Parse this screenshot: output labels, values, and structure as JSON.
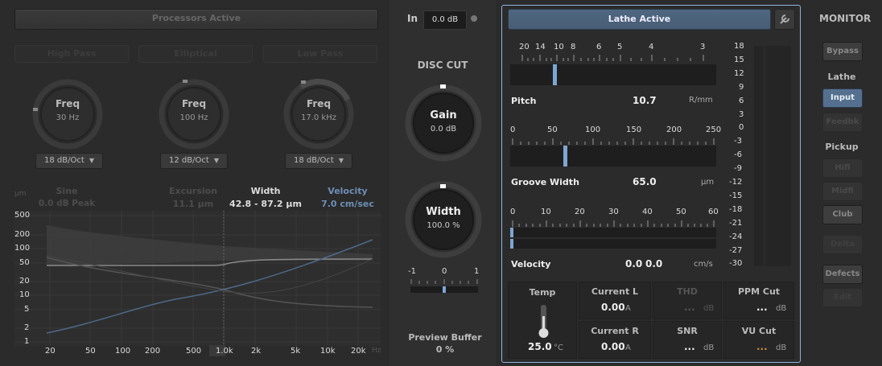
{
  "eq": {
    "processors_label": "Processors Active",
    "filters": [
      {
        "label": "High Pass"
      },
      {
        "label": "Elliptical"
      },
      {
        "label": "Low Pass"
      }
    ],
    "knobs": [
      {
        "title": "Freq",
        "value": "30 Hz",
        "slope": "18 dB/Oct"
      },
      {
        "title": "Freq",
        "value": "100 Hz",
        "slope": "12 dB/Oct"
      },
      {
        "title": "Freq",
        "value": "17.0 kHz",
        "slope": "18 dB/Oct"
      }
    ],
    "stats": {
      "sine_label": "Sine",
      "sine_value": "0.0 dB Peak",
      "excursion_label": "Excursion",
      "excursion_value": "11.1 µm",
      "width_label": "Width",
      "width_value": "42.8 - 87.2 µm",
      "velocity_label": "Velocity",
      "velocity_value": "7.0 cm/sec"
    },
    "y_unit": "µm",
    "x_unit": "Hz",
    "y_ticks": [
      "500",
      "200",
      "100",
      "50",
      "20",
      "10",
      "5",
      "2",
      "1"
    ],
    "x_ticks": [
      "20",
      "50",
      "100",
      "200",
      "500",
      "1.0k",
      "2k",
      "5k",
      "10k",
      "20k"
    ]
  },
  "disc": {
    "in_label": "In",
    "in_value": "0.0 dB",
    "title": "DISC CUT",
    "gain_title": "Gain",
    "gain_value": "0.0 dB",
    "width_title": "Width",
    "width_value": "100.0 %",
    "balance_labels": [
      "-1",
      "0",
      "1"
    ],
    "preview_label": "Preview Buffer",
    "preview_value": "0 %"
  },
  "lathe": {
    "title": "Lathe Active",
    "pitch": {
      "label": "Pitch",
      "value": "10.7",
      "unit": "R/mm",
      "ticks": [
        "20",
        "14",
        "10",
        "8",
        "6",
        "5",
        "4",
        "3"
      ]
    },
    "groove": {
      "label": "Groove Width",
      "value": "65.0",
      "unit": "µm",
      "ticks": [
        "0",
        "50",
        "100",
        "150",
        "200",
        "250"
      ]
    },
    "velocity": {
      "label": "Velocity",
      "value_l": "0.0",
      "value_r": "0.0",
      "unit": "cm/s",
      "ticks": [
        "0",
        "10",
        "20",
        "30",
        "40",
        "50",
        "60"
      ]
    },
    "meter_ticks": [
      "18",
      "15",
      "12",
      "9",
      "6",
      "3",
      "0",
      "-3",
      "-6",
      "-9",
      "-12",
      "-15",
      "-18",
      "-21",
      "-24",
      "-27",
      "-30"
    ],
    "temp": {
      "label": "Temp",
      "value": "25.0",
      "unit": "°C"
    },
    "current_l": {
      "label": "Current L",
      "value": "0.00",
      "unit": "A"
    },
    "current_r": {
      "label": "Current R",
      "value": "0.00",
      "unit": "A"
    },
    "thd": {
      "label": "THD",
      "value": "...",
      "unit": "dB"
    },
    "snr": {
      "label": "SNR",
      "value": "...",
      "unit": "dB"
    },
    "ppm": {
      "label": "PPM Cut",
      "value": "...",
      "unit": "dB"
    },
    "vu": {
      "label": "VU Cut",
      "value": "...",
      "unit": "dB"
    }
  },
  "monitor": {
    "title": "MONITOR",
    "bypass": "Bypass",
    "lathe_label": "Lathe",
    "input": "Input",
    "feedbk": "Feedbk",
    "pickup_label": "Pickup",
    "hifi": "Hifi",
    "midfi": "Midfi",
    "club": "Club",
    "delta": "Delta",
    "defects": "Defects",
    "edit": "Edit"
  },
  "colors": {
    "accent": "#7ea6d3",
    "active_button": "#55708f",
    "panel_border": "#8fb4dc"
  }
}
